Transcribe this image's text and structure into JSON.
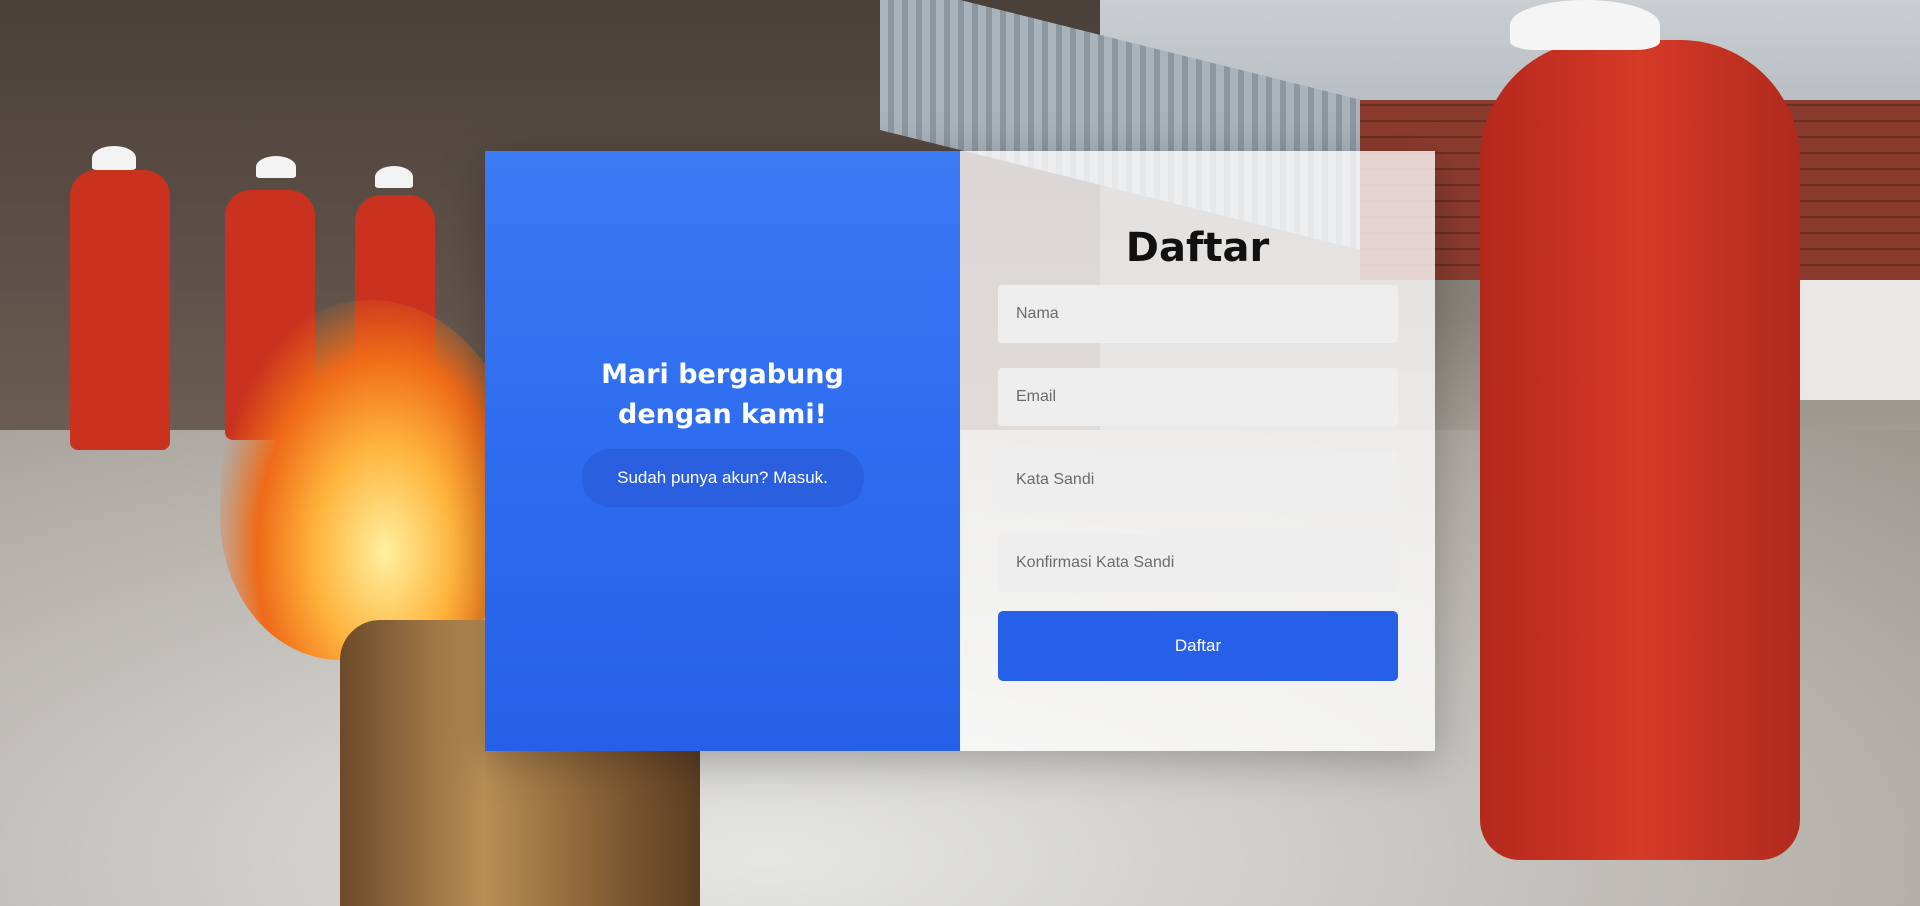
{
  "left_panel": {
    "heading": "Mari bergabung dengan kami!",
    "login_link_label": "Sudah punya akun? Masuk."
  },
  "form": {
    "title": "Daftar",
    "name_placeholder": "Nama",
    "email_placeholder": "Email",
    "password_placeholder": "Kata Sandi",
    "confirm_password_placeholder": "Konfirmasi Kata Sandi",
    "submit_label": "Daftar"
  },
  "colors": {
    "primary": "#2660e8",
    "panel_blue": "#3a7af3"
  }
}
